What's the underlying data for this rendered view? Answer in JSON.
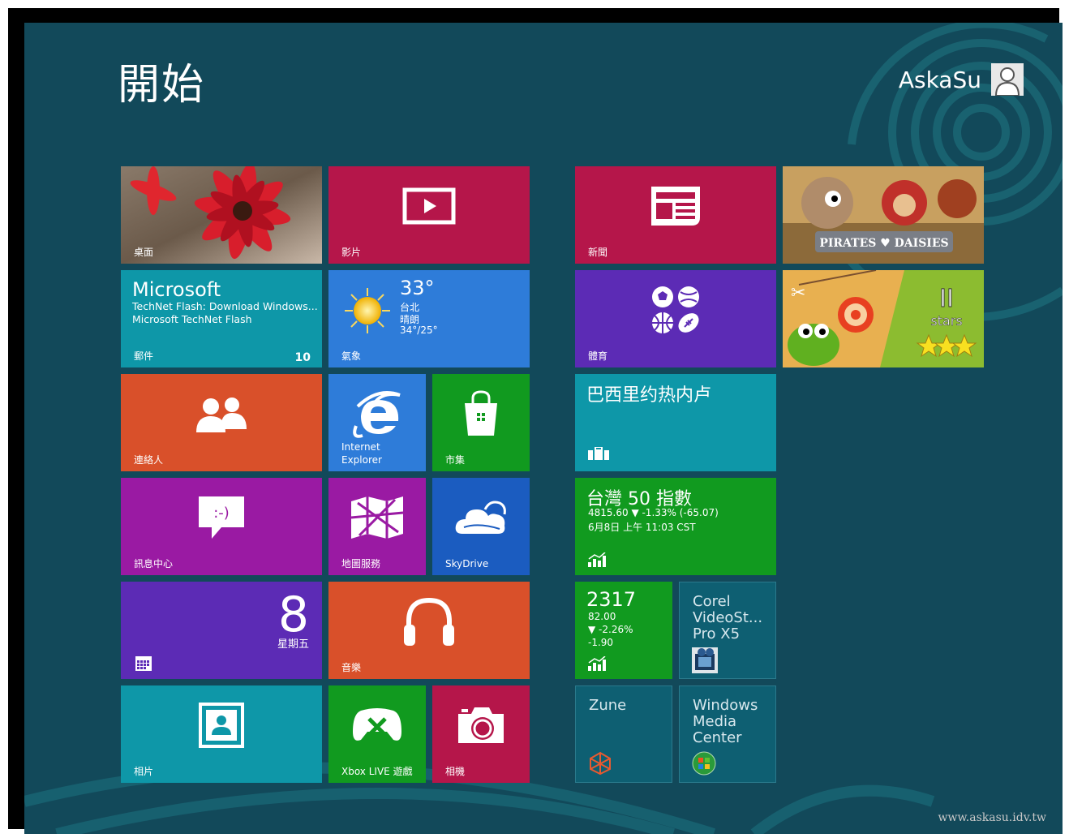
{
  "start": {
    "title": "開始"
  },
  "user": {
    "name": "AskaSu",
    "avatar_icon": "user-avatar-icon"
  },
  "tiles": {
    "desktop": {
      "label": "桌面"
    },
    "video": {
      "label": "影片"
    },
    "news": {
      "label": "新聞"
    },
    "game1": {
      "icon": "pirates-game-icon"
    },
    "mail": {
      "from": "Microsoft",
      "line1": "TechNet Flash: Download Windows...",
      "line2": "Microsoft TechNet Flash",
      "label": "郵件",
      "count": "10"
    },
    "weather": {
      "temp": "33°",
      "city": "台北",
      "condition": "晴朗",
      "range": "34°/25°",
      "label": "氣象"
    },
    "sports": {
      "label": "體育"
    },
    "game2": {
      "icon": "cut-the-rope-game-icon"
    },
    "people": {
      "label": "連絡人"
    },
    "ie": {
      "line1": "Internet",
      "line2": "Explorer"
    },
    "store": {
      "label": "市集"
    },
    "travel": {
      "headline": "巴西里约热内卢"
    },
    "messaging": {
      "label": "訊息中心"
    },
    "maps": {
      "label": "地圖服務"
    },
    "skydrive": {
      "label": "SkyDrive"
    },
    "finance": {
      "headline": "台灣 50 指數",
      "line1": "4815.60  ▼ -1.33% (-65.07)",
      "line2": "6月8日 上午 11:03 CST"
    },
    "calendar": {
      "day": "8",
      "weekday": "星期五"
    },
    "music": {
      "label": "音樂"
    },
    "stock": {
      "value": "2317",
      "price": "82.00",
      "change": "▼ -2.26%",
      "delta": "-1.90"
    },
    "corel": {
      "line1": "Corel",
      "line2": "VideoSt...",
      "line3": "Pro X5"
    },
    "photos": {
      "label": "相片"
    },
    "xbox": {
      "label": "Xbox LIVE 遊戲"
    },
    "camera": {
      "label": "相機"
    },
    "zune": {
      "title": "Zune"
    },
    "wmc": {
      "line1": "Windows",
      "line2": "Media",
      "line3": "Center"
    }
  },
  "watermark": "www.askasu.idv.tw",
  "colors": {
    "background": "#12495a",
    "crimson": "#b5164a",
    "teal": "#0e97a8",
    "blue": "#2e7cd9",
    "violet": "#5c2bb5",
    "orange": "#d9502a",
    "green": "#119a1f",
    "magenta": "#9a1aa3",
    "deepblue": "#1b5cc0",
    "appteal": "#0e5f72"
  }
}
